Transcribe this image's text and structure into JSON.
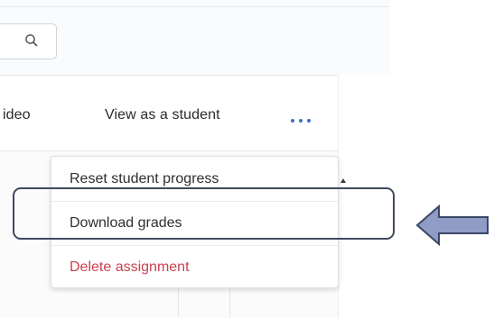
{
  "toolbar": {
    "video_partial_label": "ideo",
    "view_as_student_label": "View as a student",
    "more_icon": "more-horizontal-icon"
  },
  "search": {
    "icon": "search-icon"
  },
  "menu": {
    "items": [
      {
        "label": "Reset student progress",
        "type": "normal"
      },
      {
        "label": "Download grades",
        "type": "normal",
        "highlighted": true
      },
      {
        "label": "Delete assignment",
        "type": "danger"
      }
    ]
  },
  "annotation": {
    "arrow_icon": "left-arrow-icon",
    "arrow_color": "#8e9cc6",
    "outline_color": "#3f4a5e"
  },
  "colors": {
    "accent": "#3a6fc1",
    "danger": "#c9404f",
    "text": "#2f2f2f"
  }
}
